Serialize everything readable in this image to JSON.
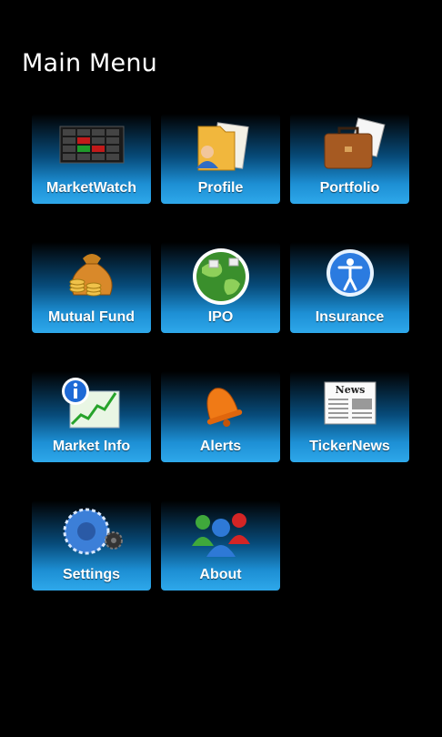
{
  "header": {
    "title": "Main Menu"
  },
  "tiles": [
    {
      "label": "MarketWatch",
      "icon": "market-ticker-board-icon"
    },
    {
      "label": "Profile",
      "icon": "profile-folder-icon"
    },
    {
      "label": "Portfolio",
      "icon": "briefcase-icon"
    },
    {
      "label": "Mutual Fund",
      "icon": "money-bag-icon"
    },
    {
      "label": "IPO",
      "icon": "globe-icon"
    },
    {
      "label": "Insurance",
      "icon": "person-badge-icon"
    },
    {
      "label": "Market Info",
      "icon": "info-chart-icon"
    },
    {
      "label": "Alerts",
      "icon": "bell-icon"
    },
    {
      "label": "TickerNews",
      "icon": "newspaper-icon"
    },
    {
      "label": "Settings",
      "icon": "gear-icon"
    },
    {
      "label": "About",
      "icon": "users-icon"
    }
  ],
  "icon_text": {
    "news": "News"
  },
  "colors": {
    "background": "#000000",
    "tile_top": "#000000",
    "tile_bottom": "#2ea8ea"
  }
}
